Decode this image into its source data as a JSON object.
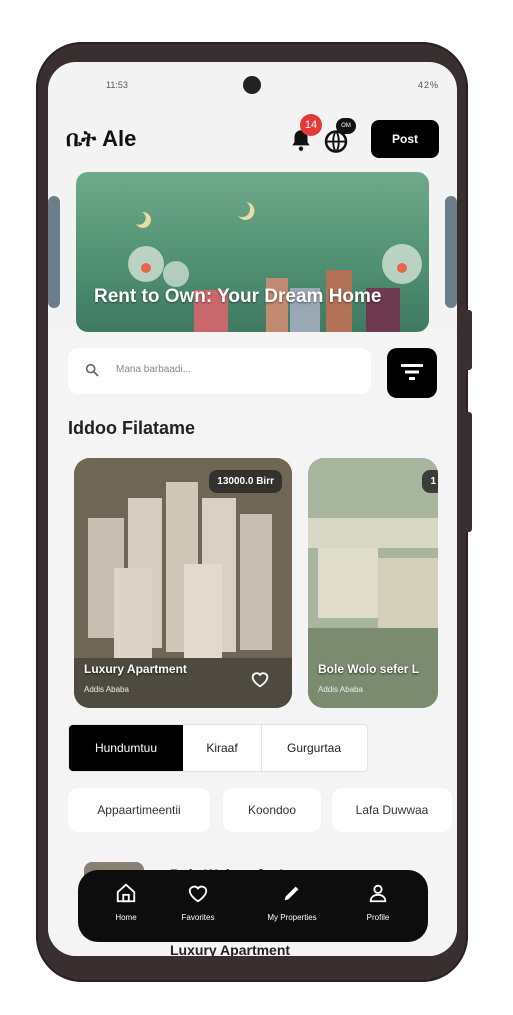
{
  "status": {
    "time": "11:53",
    "right": "42%"
  },
  "header": {
    "logo": "ቤት Ale",
    "notif_count": "14",
    "lang_badge": "OM",
    "post_label": "Post"
  },
  "banner": {
    "title": "Rent to Own: Your Dream Home"
  },
  "search": {
    "placeholder": "Mana barbaadi..."
  },
  "section_title": "Iddoo Filatame",
  "cards": [
    {
      "price": "13000.0 Birr",
      "title": "Luxury Apartment",
      "location": "Addis Ababa"
    },
    {
      "price": "1",
      "title": "Bole Wolo sefer L",
      "location": "Addis Ababa"
    }
  ],
  "segments": [
    "Hundumtuu",
    "Kiraaf",
    "Gurgurtaa"
  ],
  "categories": [
    "Appaartimeentii",
    "Koondoo",
    "Lafa Duwwaa"
  ],
  "list": [
    {
      "title": "Bole Wolo sefer Laga..."
    },
    {
      "title": "Luxury Apartment"
    }
  ],
  "nav": [
    "Home",
    "Favorites",
    "My Properties",
    "Profile"
  ],
  "colors": {
    "accent": "#000000",
    "badge": "#e53935",
    "banner": "#4f8f72"
  }
}
